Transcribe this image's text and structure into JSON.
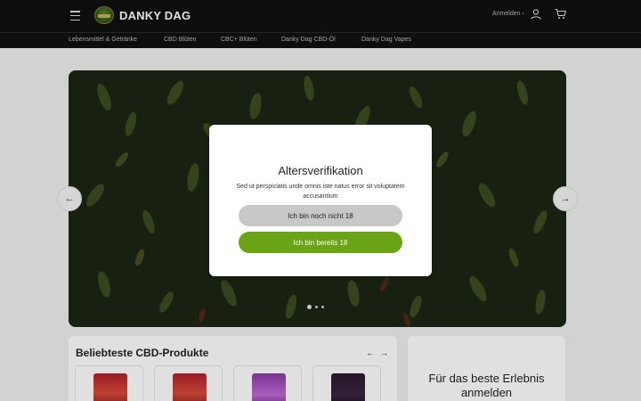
{
  "header": {
    "logo_text": "DANKY DAG",
    "login_label": "Anmelden",
    "login_chevron": "›",
    "icons": [
      "menu-icon",
      "user-icon",
      "cart-icon"
    ]
  },
  "nav": {
    "items": [
      {
        "label": "Lebensmittel & Getränke"
      },
      {
        "label": "CBD Blüten"
      },
      {
        "label": "CBC+ Blüten"
      },
      {
        "label": "Danky Dag CBD-Öl"
      },
      {
        "label": "Danky Dag Vapes"
      }
    ]
  },
  "hero": {
    "prev_arrow": "←",
    "next_arrow": "→",
    "slides": 3,
    "active_slide": 1
  },
  "products": {
    "title": "Beliebteste CBD-Produkte",
    "prev_arrow": "←",
    "next_arrow": "→"
  },
  "login_panel": {
    "title": "Für das beste Erlebnis anmelden"
  },
  "modal": {
    "title": "Altersverifikation",
    "text": "Sed ut perspiciatis unde omnis iste natus error sit voluptatem accusantium",
    "btn_no": "Ich bin noch nicht 18",
    "btn_yes": "Ich bin bereits 18"
  },
  "colors": {
    "accent_green": "#6aa416",
    "header_bg": "#111111",
    "button_grey": "#c8c8c8"
  }
}
